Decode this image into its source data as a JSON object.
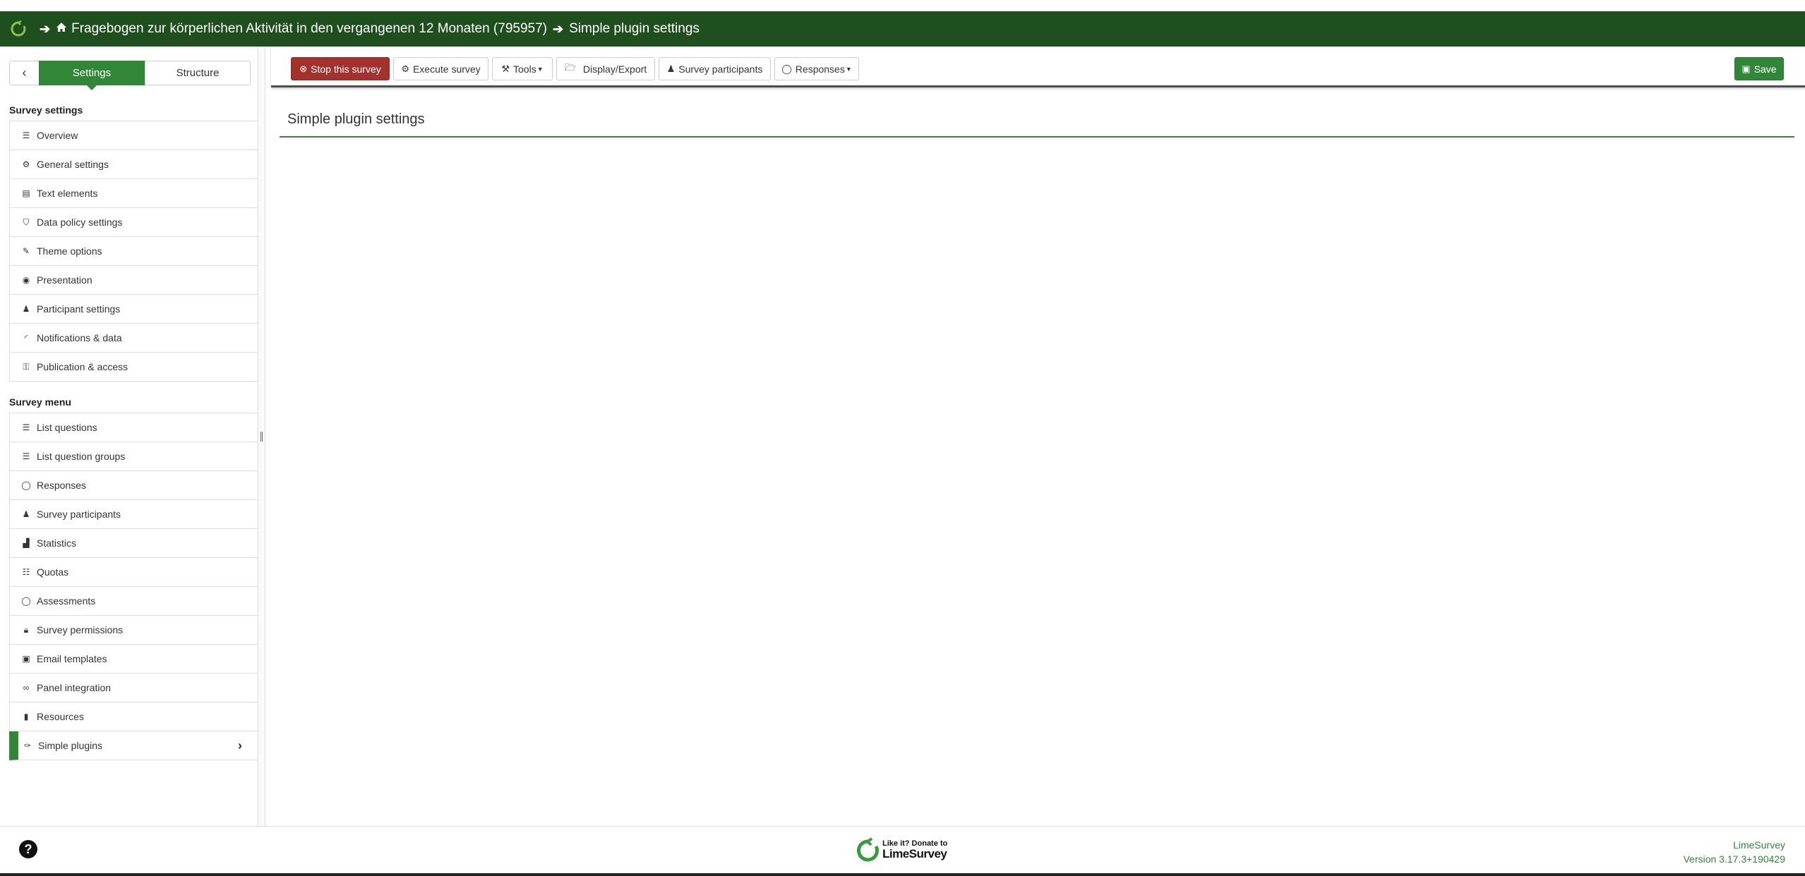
{
  "header": {
    "survey_title": "Fragebogen zur körperlichen Aktivität in den vergangenen 12 Monaten (795957)",
    "page_title": "Simple plugin settings"
  },
  "sidebar": {
    "toggle": {
      "settings_label": "Settings",
      "structure_label": "Structure"
    },
    "survey_settings_title": "Survey settings",
    "survey_settings": [
      {
        "label": "Overview",
        "icon": "list-icon"
      },
      {
        "label": "General settings",
        "icon": "cogs-icon"
      },
      {
        "label": "Text elements",
        "icon": "file-text-icon"
      },
      {
        "label": "Data policy settings",
        "icon": "shield-icon"
      },
      {
        "label": "Theme options",
        "icon": "paint-brush-icon"
      },
      {
        "label": "Presentation",
        "icon": "eye-slash-icon"
      },
      {
        "label": "Participant settings",
        "icon": "users-icon"
      },
      {
        "label": "Notifications & data",
        "icon": "feed-icon"
      },
      {
        "label": "Publication & access",
        "icon": "key-icon"
      }
    ],
    "survey_menu_title": "Survey menu",
    "survey_menu": [
      {
        "label": "List questions",
        "icon": "list-icon"
      },
      {
        "label": "List question groups",
        "icon": "list-icon"
      },
      {
        "label": "Responses",
        "icon": "comment-icon"
      },
      {
        "label": "Survey participants",
        "icon": "user-icon"
      },
      {
        "label": "Statistics",
        "icon": "bar-chart-icon"
      },
      {
        "label": "Quotas",
        "icon": "tasks-icon"
      },
      {
        "label": "Assessments",
        "icon": "comment-icon"
      },
      {
        "label": "Survey permissions",
        "icon": "lock-icon"
      },
      {
        "label": "Email templates",
        "icon": "envelope-icon"
      },
      {
        "label": "Panel integration",
        "icon": "link-icon"
      },
      {
        "label": "Resources",
        "icon": "file-icon"
      },
      {
        "label": "Simple plugins",
        "icon": "plug-icon"
      }
    ]
  },
  "toolbar": {
    "stop_label": "Stop this survey",
    "execute_label": "Execute survey",
    "tools_label": "Tools",
    "display_export_label": "Display/Export",
    "participants_label": "Survey participants",
    "responses_label": "Responses",
    "save_label": "Save"
  },
  "content": {
    "title": "Simple plugin settings"
  },
  "footer": {
    "donate_small": "Like it? Donate to",
    "donate_brand": "LimeSurvey",
    "app_name": "LimeSurvey",
    "version": "Version 3.17.3+190429"
  },
  "colors": {
    "header_bg": "#1f4e1f",
    "accent_green": "#328637",
    "stop_red": "#a3312d"
  }
}
